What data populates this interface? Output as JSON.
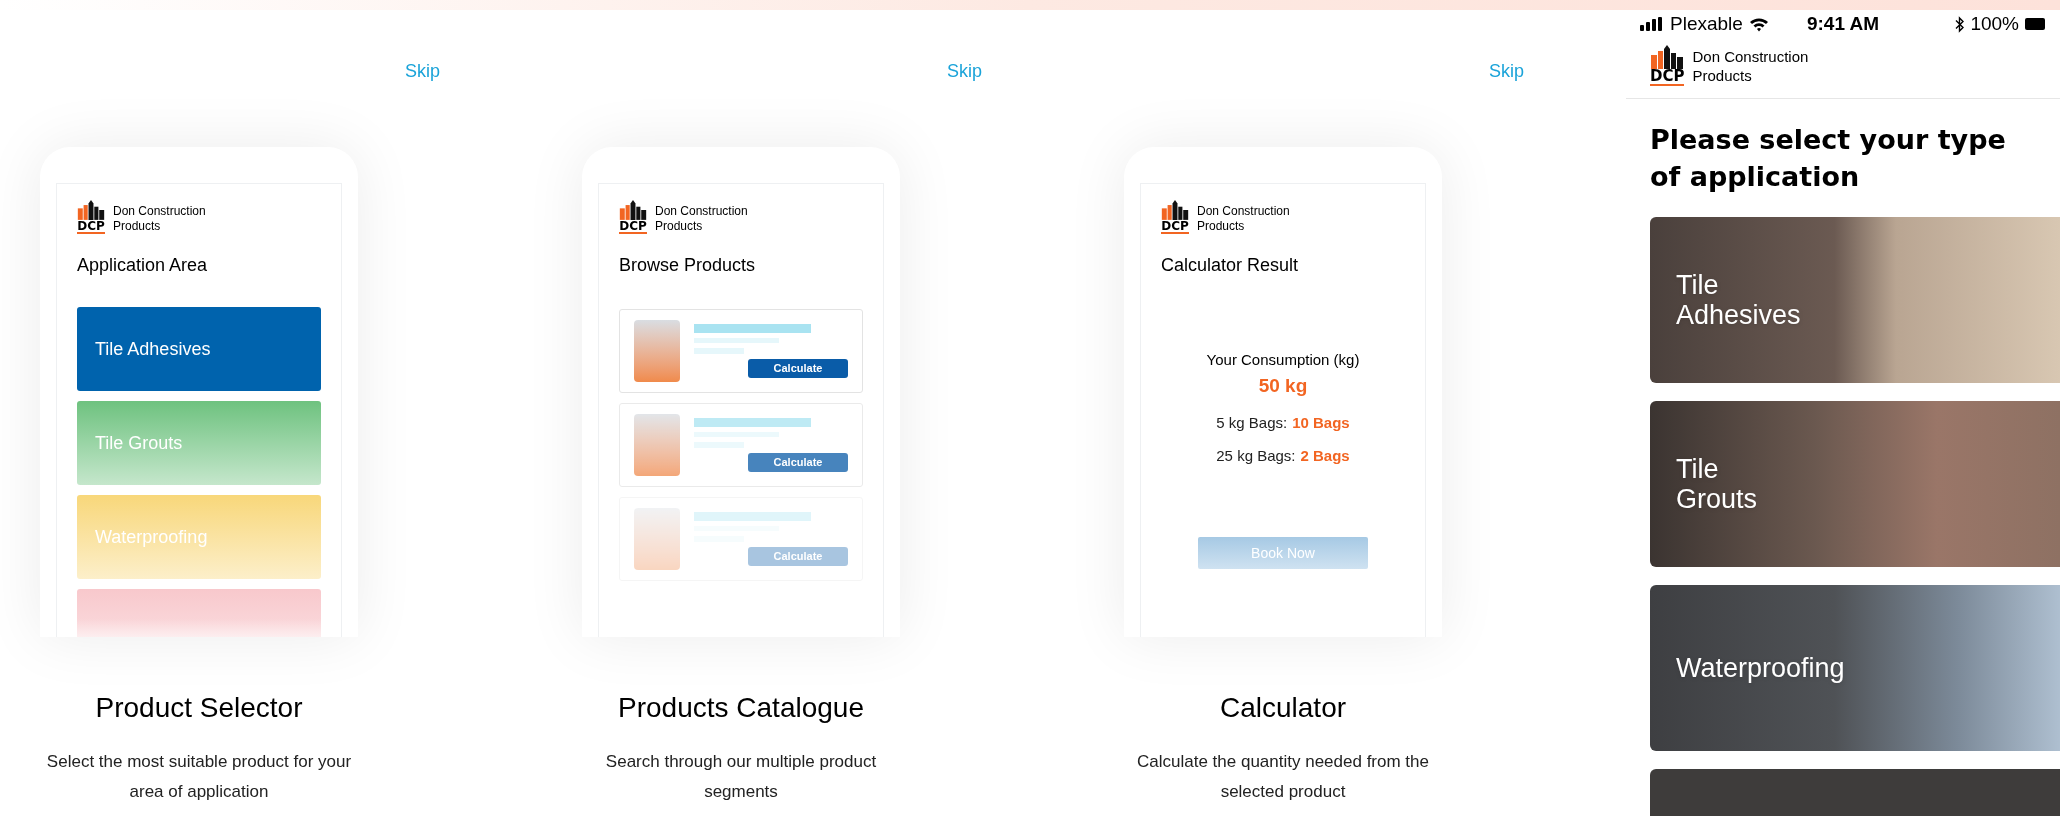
{
  "slides": [
    {
      "skip": "Skip",
      "title": "Product Selector",
      "description": "Select the most suitable product for your area of application",
      "screen": {
        "kind": "selector",
        "brand": {
          "mark": "DCP",
          "name_lines": [
            "Don Construction",
            "Products"
          ]
        },
        "heading": "Application Area",
        "items": [
          {
            "label": "Tile Adhesives",
            "color": "#0063ad"
          },
          {
            "label": "Tile Grouts",
            "color": "#6ec27f"
          },
          {
            "label": "Waterproofing",
            "color": "#f8d77a"
          },
          {
            "color": "#f8c8cc"
          }
        ]
      }
    },
    {
      "skip": "Skip",
      "title": "Products Catalogue",
      "description": "Search through our multiple product segments",
      "screen": {
        "kind": "catalogue",
        "brand": {
          "mark": "DCP",
          "name_lines": [
            "Don Construction",
            "Products"
          ]
        },
        "heading": "Browse Products",
        "products": [
          {
            "button": "Calculate"
          },
          {
            "button": "Calculate"
          },
          {
            "button": "Calculate"
          }
        ]
      }
    },
    {
      "skip": "Skip",
      "title": "Calculator",
      "description": "Calculate the quantity needed from the selected product",
      "screen": {
        "kind": "calculator",
        "brand": {
          "mark": "DCP",
          "name_lines": [
            "Don Construction",
            "Products"
          ]
        },
        "heading": "Calculator Result",
        "consumption_label": "Your Consumption (kg)",
        "consumption_value": "50 kg",
        "bags": [
          {
            "label": "5 kg Bags:",
            "value": "10 Bags"
          },
          {
            "label": "25 kg Bags:",
            "value": "2 Bags"
          }
        ],
        "button": "Book Now"
      }
    }
  ],
  "app": {
    "status_bar": {
      "carrier": "Plexable",
      "time": "9:41 AM",
      "battery": "100%"
    },
    "brand": {
      "mark": "DCP",
      "name_lines": [
        "Don Construction",
        "Products"
      ]
    },
    "heading": "Please select your type of application",
    "cards": [
      {
        "label": "Tile Adhesives"
      },
      {
        "label": "Tile Grouts"
      },
      {
        "label": "Waterproofing"
      }
    ]
  }
}
